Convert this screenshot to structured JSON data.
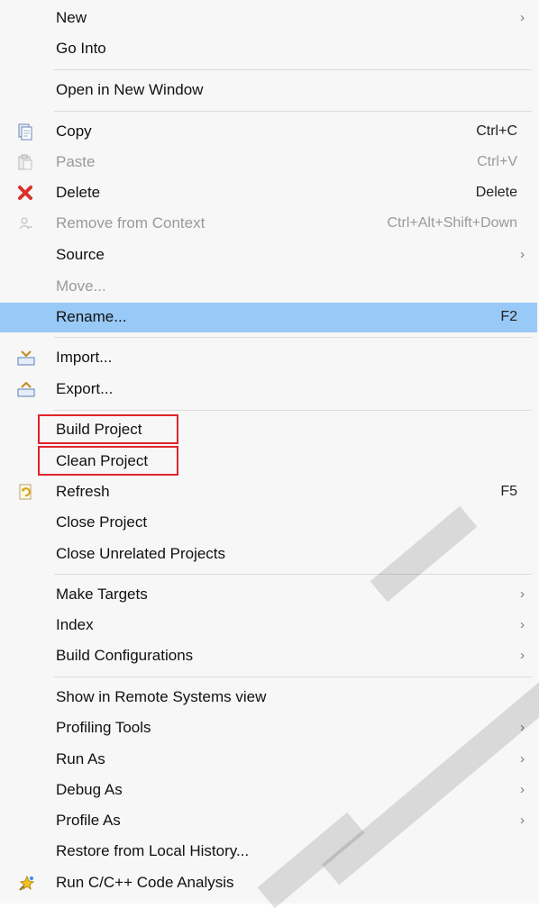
{
  "menu": {
    "items": [
      {
        "label": "New",
        "shortcut": "",
        "submenu": true,
        "disabled": false,
        "icon": ""
      },
      {
        "label": "Go Into",
        "shortcut": "",
        "submenu": false,
        "disabled": false,
        "icon": ""
      },
      {
        "label": "Open in New Window",
        "shortcut": "",
        "submenu": false,
        "disabled": false,
        "icon": ""
      },
      {
        "label": "Copy",
        "shortcut": "Ctrl+C",
        "submenu": false,
        "disabled": false,
        "icon": "copy-icon"
      },
      {
        "label": "Paste",
        "shortcut": "Ctrl+V",
        "submenu": false,
        "disabled": true,
        "icon": "paste-icon"
      },
      {
        "label": "Delete",
        "shortcut": "Delete",
        "submenu": false,
        "disabled": false,
        "icon": "delete-icon"
      },
      {
        "label": "Remove from Context",
        "shortcut": "Ctrl+Alt+Shift+Down",
        "submenu": false,
        "disabled": true,
        "icon": "remove-context-icon"
      },
      {
        "label": "Source",
        "shortcut": "",
        "submenu": true,
        "disabled": false,
        "icon": ""
      },
      {
        "label": "Move...",
        "shortcut": "",
        "submenu": false,
        "disabled": true,
        "icon": ""
      },
      {
        "label": "Rename...",
        "shortcut": "F2",
        "submenu": false,
        "disabled": false,
        "icon": ""
      },
      {
        "label": "Import...",
        "shortcut": "",
        "submenu": false,
        "disabled": false,
        "icon": "import-icon"
      },
      {
        "label": "Export...",
        "shortcut": "",
        "submenu": false,
        "disabled": false,
        "icon": "export-icon"
      },
      {
        "label": "Build Project",
        "shortcut": "",
        "submenu": false,
        "disabled": false,
        "icon": ""
      },
      {
        "label": "Clean Project",
        "shortcut": "",
        "submenu": false,
        "disabled": false,
        "icon": ""
      },
      {
        "label": "Refresh",
        "shortcut": "F5",
        "submenu": false,
        "disabled": false,
        "icon": "refresh-icon"
      },
      {
        "label": "Close Project",
        "shortcut": "",
        "submenu": false,
        "disabled": false,
        "icon": ""
      },
      {
        "label": "Close Unrelated Projects",
        "shortcut": "",
        "submenu": false,
        "disabled": false,
        "icon": ""
      },
      {
        "label": "Make Targets",
        "shortcut": "",
        "submenu": true,
        "disabled": false,
        "icon": ""
      },
      {
        "label": "Index",
        "shortcut": "",
        "submenu": true,
        "disabled": false,
        "icon": ""
      },
      {
        "label": "Build Configurations",
        "shortcut": "",
        "submenu": true,
        "disabled": false,
        "icon": ""
      },
      {
        "label": "Show in Remote Systems view",
        "shortcut": "",
        "submenu": false,
        "disabled": false,
        "icon": ""
      },
      {
        "label": "Profiling Tools",
        "shortcut": "",
        "submenu": true,
        "disabled": false,
        "icon": ""
      },
      {
        "label": "Run As",
        "shortcut": "",
        "submenu": true,
        "disabled": false,
        "icon": ""
      },
      {
        "label": "Debug As",
        "shortcut": "",
        "submenu": true,
        "disabled": false,
        "icon": ""
      },
      {
        "label": "Profile As",
        "shortcut": "",
        "submenu": true,
        "disabled": false,
        "icon": ""
      },
      {
        "label": "Restore from Local History...",
        "shortcut": "",
        "submenu": false,
        "disabled": false,
        "icon": ""
      },
      {
        "label": "Run C/C++ Code Analysis",
        "shortcut": "",
        "submenu": false,
        "disabled": false,
        "icon": "code-analysis-icon"
      }
    ],
    "selected_label": "Rename...",
    "highlighted_labels": [
      "Build Project",
      "Clean Project"
    ],
    "submenu_arrow": "›"
  },
  "colors": {
    "selection": "#99c9f6",
    "annotation_box": "#e0242d",
    "disabled_text": "#9a9a9a"
  }
}
